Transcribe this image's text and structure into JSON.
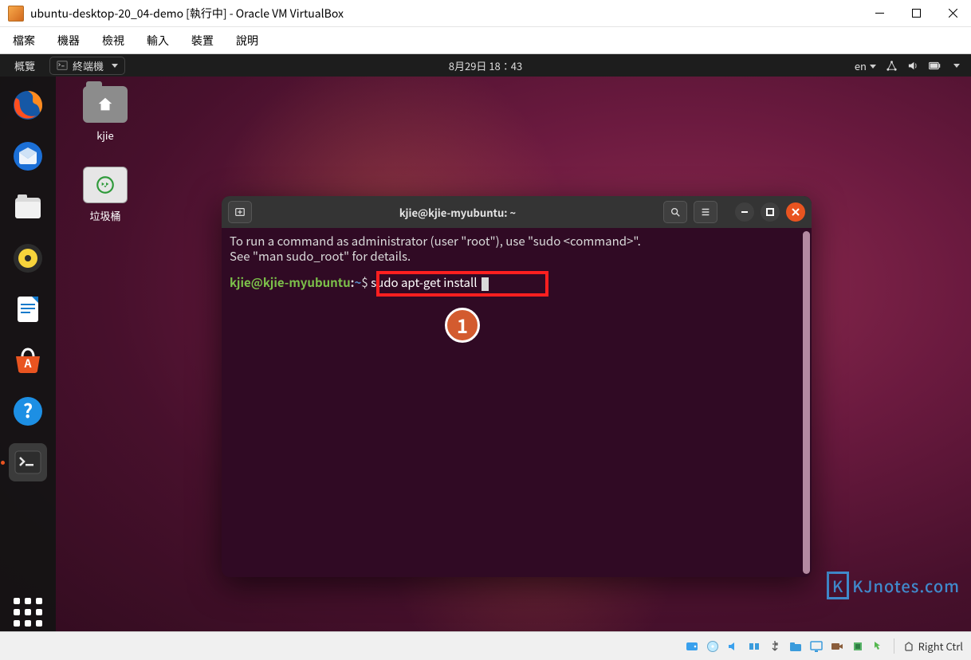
{
  "host": {
    "title": "ubuntu-desktop-20_04-demo [執行中] - Oracle VM VirtualBox",
    "menu": [
      "檔案",
      "機器",
      "檢視",
      "輸入",
      "裝置",
      "說明"
    ],
    "hostkey_label": "Right Ctrl"
  },
  "gnome_top": {
    "activities": "概覽",
    "app_indicator": "終端機",
    "datetime": "8月29日  18：43",
    "lang": "en"
  },
  "desktop": {
    "home_label": "kjie",
    "trash_label": "垃圾桶"
  },
  "dock_items": [
    {
      "name": "firefox",
      "running": false
    },
    {
      "name": "thunderbird",
      "running": false
    },
    {
      "name": "files",
      "running": false
    },
    {
      "name": "rhythmbox",
      "running": false
    },
    {
      "name": "libreoffice-writer",
      "running": false
    },
    {
      "name": "software",
      "running": false
    },
    {
      "name": "help",
      "running": false
    },
    {
      "name": "terminal",
      "running": true,
      "active": true
    }
  ],
  "terminal": {
    "title": "kjie@kjie-myubuntu: ~",
    "motd": "To run a command as administrator (user \"root\"), use \"sudo <command>\".\nSee \"man sudo_root\" for details.",
    "prompt_user": "kjie@kjie-myubuntu",
    "prompt_sep": ":",
    "prompt_path": "~",
    "prompt_symbol": "$",
    "command": "sudo apt-get install "
  },
  "callout": {
    "badge": "1"
  },
  "watermark": "KJnotes.com"
}
